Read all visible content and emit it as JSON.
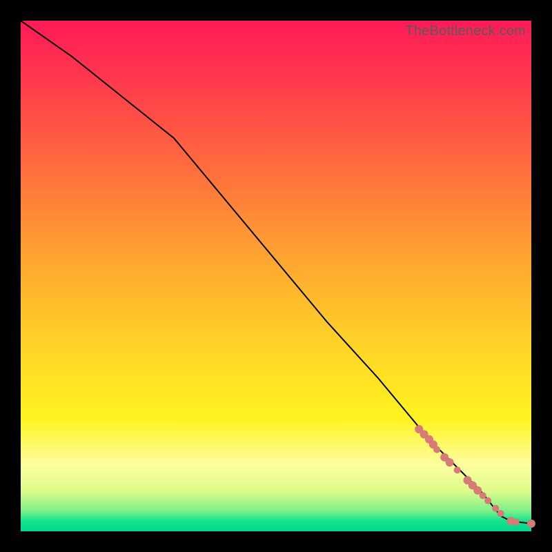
{
  "watermark": "TheBottleneck.com",
  "colors": {
    "dot": "#d77a78",
    "line": "#000000",
    "frame": "#000000"
  },
  "chart_data": {
    "type": "line",
    "title": "",
    "xlabel": "",
    "ylabel": "",
    "xlim": [
      0,
      100
    ],
    "ylim": [
      0,
      100
    ],
    "grid": false,
    "series": [
      {
        "name": "curve",
        "x": [
          0,
          10,
          20,
          30,
          40,
          50,
          60,
          70,
          80,
          90,
          94,
          96,
          100
        ],
        "y": [
          100,
          93,
          85,
          77,
          65,
          53,
          41,
          30,
          18,
          8,
          3,
          2,
          1.5
        ]
      }
    ],
    "points": [
      {
        "name": "cluster",
        "x": 78.0,
        "y": 20.0,
        "r": 6
      },
      {
        "name": "cluster",
        "x": 79.0,
        "y": 19.0,
        "r": 6
      },
      {
        "name": "cluster",
        "x": 80.0,
        "y": 18.0,
        "r": 6
      },
      {
        "name": "cluster",
        "x": 80.8,
        "y": 17.0,
        "r": 6
      },
      {
        "name": "cluster",
        "x": 81.5,
        "y": 16.0,
        "r": 5
      },
      {
        "name": "cluster",
        "x": 83.0,
        "y": 14.5,
        "r": 6
      },
      {
        "name": "cluster",
        "x": 84.0,
        "y": 13.5,
        "r": 6
      },
      {
        "name": "cluster",
        "x": 85.5,
        "y": 12.0,
        "r": 5
      },
      {
        "name": "cluster",
        "x": 87.5,
        "y": 10.0,
        "r": 6
      },
      {
        "name": "cluster",
        "x": 88.5,
        "y": 9.0,
        "r": 6
      },
      {
        "name": "cluster",
        "x": 89.5,
        "y": 8.0,
        "r": 6
      },
      {
        "name": "cluster",
        "x": 90.5,
        "y": 7.0,
        "r": 5
      },
      {
        "name": "cluster",
        "x": 91.5,
        "y": 6.0,
        "r": 5
      },
      {
        "name": "cluster",
        "x": 93.0,
        "y": 4.5,
        "r": 5
      },
      {
        "name": "cluster",
        "x": 94.0,
        "y": 3.5,
        "r": 5
      },
      {
        "name": "cluster",
        "x": 96.0,
        "y": 2.0,
        "r": 6
      },
      {
        "name": "cluster",
        "x": 97.0,
        "y": 1.8,
        "r": 5
      },
      {
        "name": "cluster",
        "x": 100.0,
        "y": 1.5,
        "r": 6
      }
    ]
  }
}
